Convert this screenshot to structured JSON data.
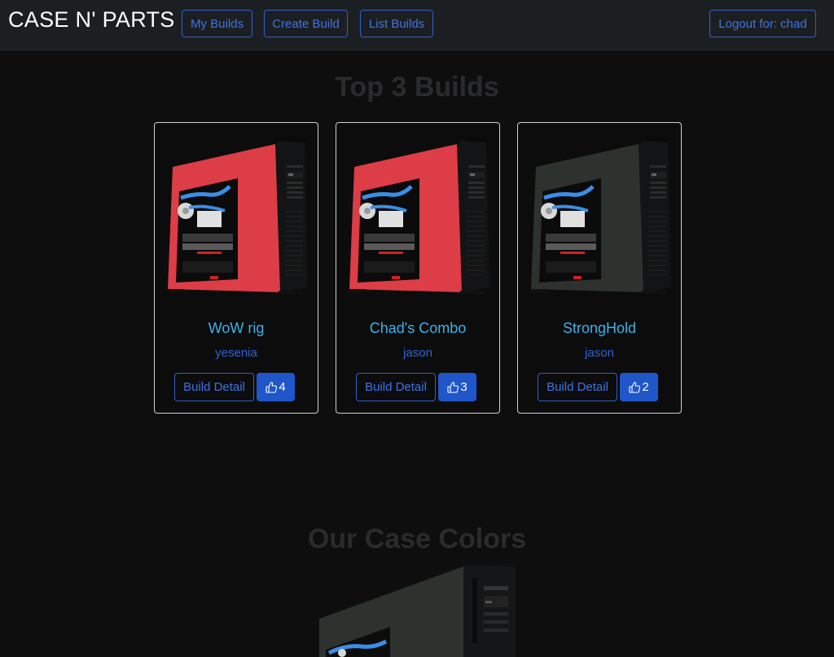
{
  "nav": {
    "brand": "CASE N' PARTS",
    "links": [
      "My Builds",
      "Create Build",
      "List Builds"
    ],
    "logout_label": "Logout for: chad"
  },
  "top_section": {
    "title": "Top 3 Builds"
  },
  "builds": [
    {
      "name": "WoW rig",
      "user": "yesenia",
      "detail_label": "Build Detail",
      "likes": "4",
      "case_color": "#dd3d46"
    },
    {
      "name": "Chad's Combo",
      "user": "jason",
      "detail_label": "Build Detail",
      "likes": "3",
      "case_color": "#dd3d46"
    },
    {
      "name": "StrongHold",
      "user": "jason",
      "detail_label": "Build Detail",
      "likes": "2",
      "case_color": "#2e322f"
    }
  ],
  "colors_section": {
    "title": "Our Case Colors"
  },
  "colors": {
    "accent": "#3d73e8",
    "title": "#3ab2e8",
    "like_bg": "#1f56c9",
    "background": "#0e0e0f"
  }
}
